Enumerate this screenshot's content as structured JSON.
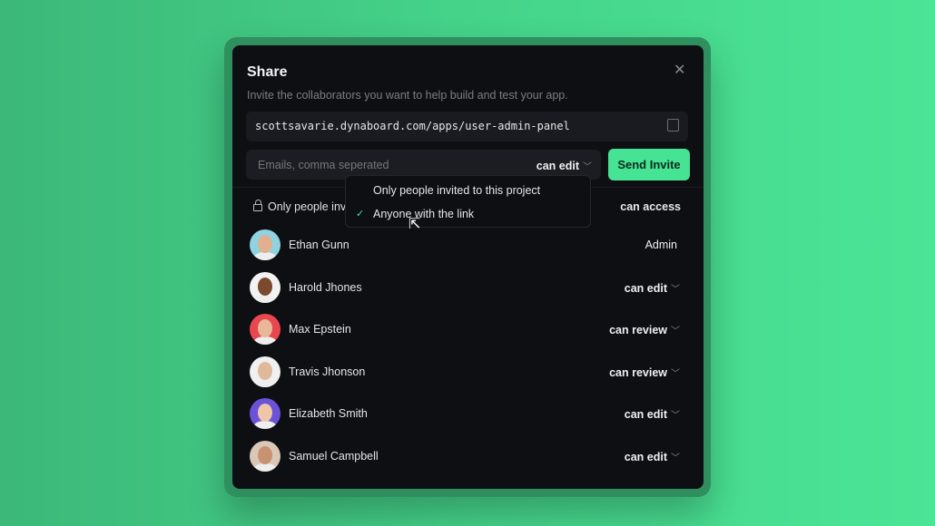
{
  "dialog": {
    "title": "Share",
    "subtitle": "Invite the collaborators you want to help build and test your app.",
    "url": "scottsavarie.dynaboard.com/apps/user-admin-panel",
    "email_placeholder": "Emails, comma seperated",
    "invite_permission": "can edit",
    "send_label": "Send Invite",
    "close_icon": "close-icon",
    "copy_icon": "copy-icon"
  },
  "access": {
    "label": "Only people inv",
    "right_label": "can access",
    "options": [
      "Only people invited to this project",
      "Anyone with the link"
    ],
    "selected": "Anyone with the link"
  },
  "members": [
    {
      "name": "Ethan Gunn",
      "role": "Admin",
      "color": "#8fd3e0",
      "face": "#e2b08e"
    },
    {
      "name": "Harold Jhones",
      "role": "can edit",
      "color": "#f2f2f2",
      "face": "#7a4a2e"
    },
    {
      "name": "Max Epstein",
      "role": "can review",
      "color": "#e8474f",
      "face": "#e9b799"
    },
    {
      "name": "Travis Jhonson",
      "role": "can review",
      "color": "#f0f0f0",
      "face": "#e0b89a"
    },
    {
      "name": "Elizabeth Smith",
      "role": "can edit",
      "color": "#6b52d9",
      "face": "#f0c6a8"
    },
    {
      "name": "Samuel Campbell",
      "role": "can edit",
      "color": "#d9c8b8",
      "face": "#c89272"
    }
  ],
  "colors": {
    "accent": "#46e395",
    "modal_bg": "#0e0f13"
  }
}
